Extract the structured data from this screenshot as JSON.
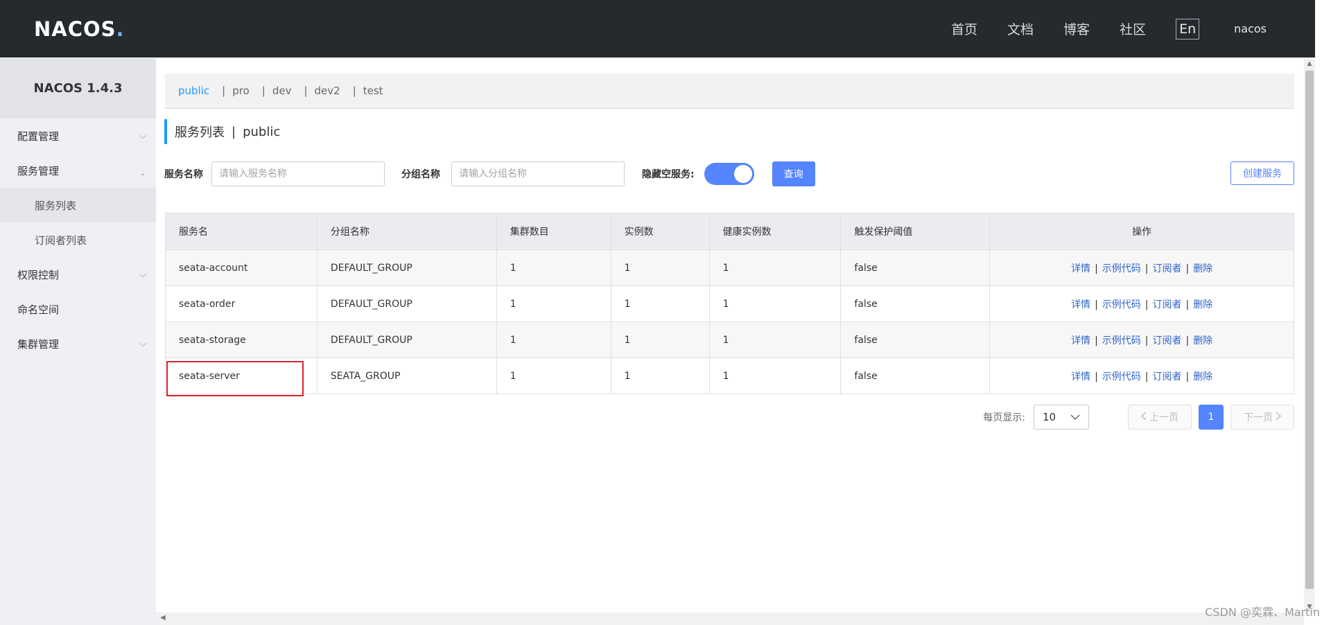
{
  "header": {
    "logo_text": "NAC",
    "logo_o": "O",
    "logo_s": "S",
    "logo_dot": ".",
    "nav": [
      "首页",
      "文档",
      "博客",
      "社区"
    ],
    "lang": "En",
    "user": "nacos"
  },
  "sidebar": {
    "version": "NACOS 1.4.3",
    "items": [
      {
        "label": "配置管理",
        "chevron": "down"
      },
      {
        "label": "服务管理",
        "chevron": "up"
      },
      {
        "label": "服务列表"
      },
      {
        "label": "订阅者列表"
      },
      {
        "label": "权限控制",
        "chevron": "down"
      },
      {
        "label": "命名空间"
      },
      {
        "label": "集群管理",
        "chevron": "down"
      }
    ]
  },
  "namespaces": {
    "items": [
      "public",
      "pro",
      "dev",
      "dev2",
      "test"
    ],
    "sep": "|",
    "active": "public"
  },
  "title": {
    "main": "服务列表",
    "divider": "|",
    "namespace": "public"
  },
  "filters": {
    "service_label": "服务名称",
    "service_placeholder": "请输入服务名称",
    "group_label": "分组名称",
    "group_placeholder": "请输入分组名称",
    "hide_empty_label": "隐藏空服务:",
    "search_button": "查询",
    "create_button": "创建服务"
  },
  "table": {
    "headers": [
      "服务名",
      "分组名称",
      "集群数目",
      "实例数",
      "健康实例数",
      "触发保护阈值",
      "操作"
    ],
    "rows": [
      [
        "seata-account",
        "DEFAULT_GROUP",
        "1",
        "1",
        "1",
        "false"
      ],
      [
        "seata-order",
        "DEFAULT_GROUP",
        "1",
        "1",
        "1",
        "false"
      ],
      [
        "seata-storage",
        "DEFAULT_GROUP",
        "1",
        "1",
        "1",
        "false"
      ],
      [
        "seata-server",
        "SEATA_GROUP",
        "1",
        "1",
        "1",
        "false"
      ]
    ],
    "ops": [
      "详情",
      "示例代码",
      "订阅者",
      "删除"
    ],
    "op_sep": "|"
  },
  "pagination": {
    "per_page_label": "每页显示:",
    "page_size": "10",
    "prev": "上一页",
    "current": "1",
    "next": "下一页"
  },
  "watermark": "CSDN @奕霖、Martin",
  "colors": {
    "header_bg": "#252a2f",
    "accent": "#209bfa",
    "primary": "#5584ff",
    "link": "#2f64c9",
    "highlight": "#d9232a"
  }
}
